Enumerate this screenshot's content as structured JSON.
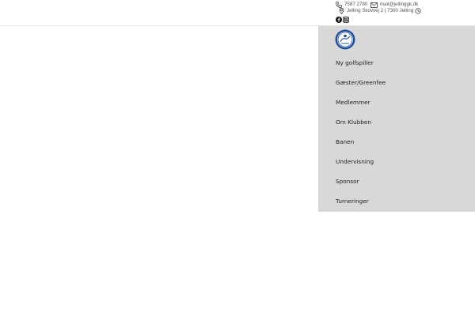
{
  "header": {
    "phone": "7587 2780",
    "email": "mail@jellinggk.dk",
    "address": "Jelling Skovvej 2 | 7300 Jelling",
    "icons": [
      "phone-icon",
      "mail-icon",
      "location-pin-icon",
      "clock-icon",
      "facebook-icon",
      "instagram-icon"
    ]
  },
  "menu": {
    "logo_icon": "club-logo",
    "items": [
      {
        "label": "Ny golfspiller"
      },
      {
        "label": "Gæster/Greenfee"
      },
      {
        "label": "Medlemmer"
      },
      {
        "label": "Om Klubben"
      },
      {
        "label": "Banen"
      },
      {
        "label": "Undervisning"
      },
      {
        "label": "Sponsor"
      },
      {
        "label": "Turneringer"
      }
    ]
  },
  "colors": {
    "menu_background": "#d8d8d8",
    "logo_blue": "#1e4f9c"
  }
}
